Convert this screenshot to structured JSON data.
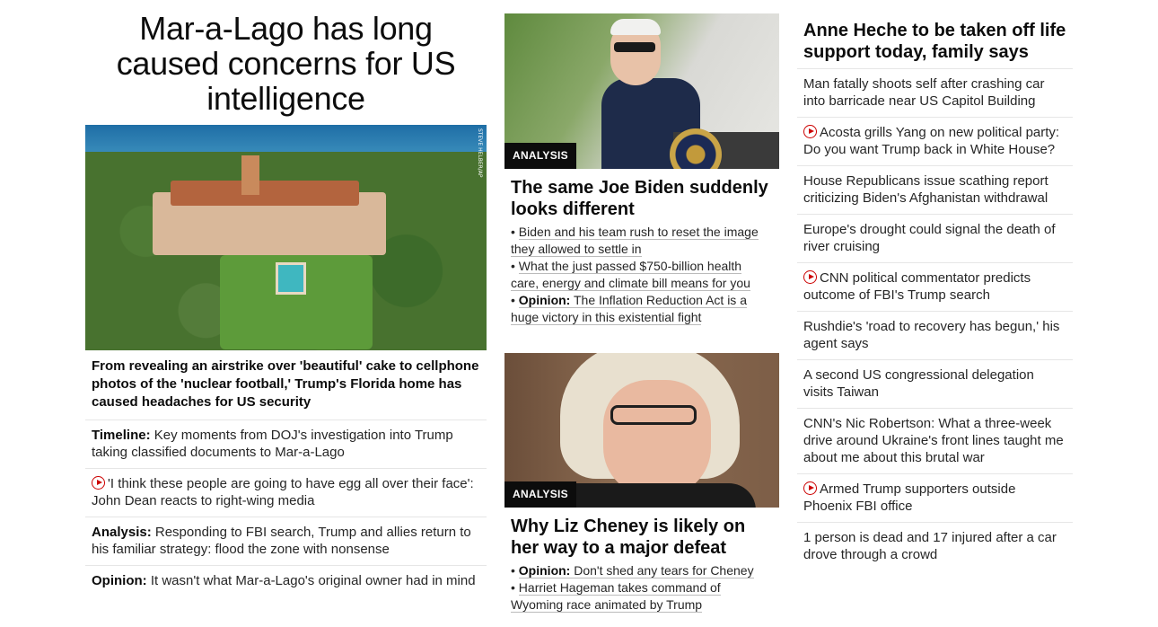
{
  "col1": {
    "hero_title": "Mar-a-Lago has long caused concerns for US intelligence",
    "image_credit": "STEVE HELBER/AP",
    "hero_description": "From revealing an airstrike over 'beautiful' cake to cellphone photos of the 'nuclear football,' Trump's Florida home has caused headaches for US security",
    "items": [
      {
        "prefix": "Timeline:",
        "text": " Key moments from DOJ's investigation into Trump taking classified documents to Mar-a-Lago",
        "video": false
      },
      {
        "prefix": "",
        "text": "'I think these people are going to have egg all over their face': John Dean reacts to right-wing media",
        "video": true
      },
      {
        "prefix": "Analysis:",
        "text": " Responding to FBI search, Trump and allies return to his familiar strategy: flood the zone with nonsense",
        "video": false
      },
      {
        "prefix": "Opinion:",
        "text": " It wasn't what Mar-a-Lago's original owner had in mind",
        "video": false
      }
    ]
  },
  "col2": {
    "card1": {
      "badge": "ANALYSIS",
      "title": "The same Joe Biden suddenly looks different",
      "bullets": [
        {
          "prefix": "",
          "text": "Biden and his team rush to reset the image they allowed to settle in"
        },
        {
          "prefix": "",
          "text": "What the just passed $750-billion health care, energy and climate bill means for you"
        },
        {
          "prefix": "Opinion:",
          "text": " The Inflation Reduction Act is a huge victory in this existential fight"
        }
      ]
    },
    "card2": {
      "badge": "ANALYSIS",
      "title": "Why Liz Cheney is likely on her way to a major defeat",
      "bullets": [
        {
          "prefix": "Opinion:",
          "text": " Don't shed any tears for Cheney"
        },
        {
          "prefix": "",
          "text": "Harriet Hageman takes command of Wyoming race animated by Trump"
        }
      ]
    }
  },
  "col3": {
    "top_headline": "Anne Heche to be taken off life support today, family says",
    "items": [
      {
        "text": "Man fatally shoots self after crashing car into barricade near US Capitol Building",
        "video": false
      },
      {
        "text": "Acosta grills Yang on new political party: Do you want Trump back in White House?",
        "video": true
      },
      {
        "text": "House Republicans issue scathing report criticizing Biden's Afghanistan withdrawal",
        "video": false
      },
      {
        "text": "Europe's drought could signal the death of river cruising",
        "video": false
      },
      {
        "text": "CNN political commentator predicts outcome of FBI's Trump search",
        "video": true
      },
      {
        "text": "Rushdie's 'road to recovery has begun,' his agent says",
        "video": false
      },
      {
        "text": "A second US congressional delegation visits Taiwan",
        "video": false
      },
      {
        "text": "CNN's Nic Robertson: What a three-week drive around Ukraine's front lines taught me about me about this brutal war",
        "video": false
      },
      {
        "text": "Armed Trump supporters outside Phoenix FBI office",
        "video": true
      },
      {
        "text": "1 person is dead and 17 injured after a car drove through a crowd",
        "video": false
      }
    ]
  },
  "colors": {
    "video_icon": "#cc0000",
    "divider": "#e6e6e6",
    "badge_bg": "#0c0c0c"
  },
  "icons": {
    "video": "play-circle-icon"
  }
}
